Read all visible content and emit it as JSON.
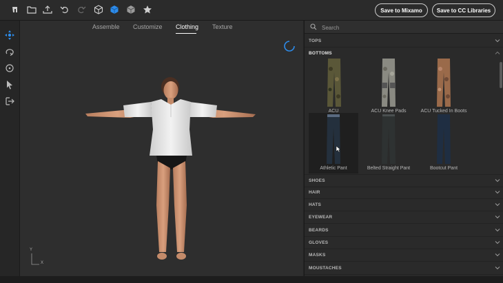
{
  "toolbar": {
    "icons": [
      "logo-icon",
      "folder-icon",
      "upload-icon",
      "undo-icon",
      "redo-icon",
      "cube-outline-icon",
      "cube-active-icon",
      "cube-shaded-icon",
      "star-icon"
    ],
    "save_mixamo_label": "Save to Mixamo",
    "save_cc_label": "Save to CC Libraries"
  },
  "left_tools": [
    "move-icon",
    "orbit-icon",
    "rotate-icon",
    "select-icon",
    "export-icon"
  ],
  "tabs": [
    {
      "label": "Assemble",
      "active": false
    },
    {
      "label": "Customize",
      "active": false
    },
    {
      "label": "Clothing",
      "active": true
    },
    {
      "label": "Texture",
      "active": false
    }
  ],
  "axis": {
    "x": "X",
    "y": "Y"
  },
  "panel": {
    "search_placeholder": "Search",
    "sections_top": [
      {
        "label": "TOPS",
        "open": false
      },
      {
        "label": "BOTTOMS",
        "open": true
      }
    ],
    "items": [
      {
        "label": "ACU",
        "pattern": "woodland-camo"
      },
      {
        "label": "ACU Knee Pads",
        "pattern": "gray-camo"
      },
      {
        "label": "ACU Tucked In Boots",
        "pattern": "desert-camo"
      },
      {
        "label": "Athletic Pant",
        "pattern": "dark-navy",
        "selected": true
      },
      {
        "label": "Belted Straight Pant",
        "pattern": "charcoal"
      },
      {
        "label": "Bootcut Pant",
        "pattern": "denim"
      }
    ],
    "sections_bottom": [
      {
        "label": "SHOES"
      },
      {
        "label": "HAIR"
      },
      {
        "label": "HATS"
      },
      {
        "label": "EYEWEAR"
      },
      {
        "label": "BEARDS"
      },
      {
        "label": "GLOVES"
      },
      {
        "label": "MASKS"
      },
      {
        "label": "MOUSTACHES"
      }
    ]
  },
  "colors": {
    "accent": "#2d8ceb",
    "background": "#232323"
  }
}
